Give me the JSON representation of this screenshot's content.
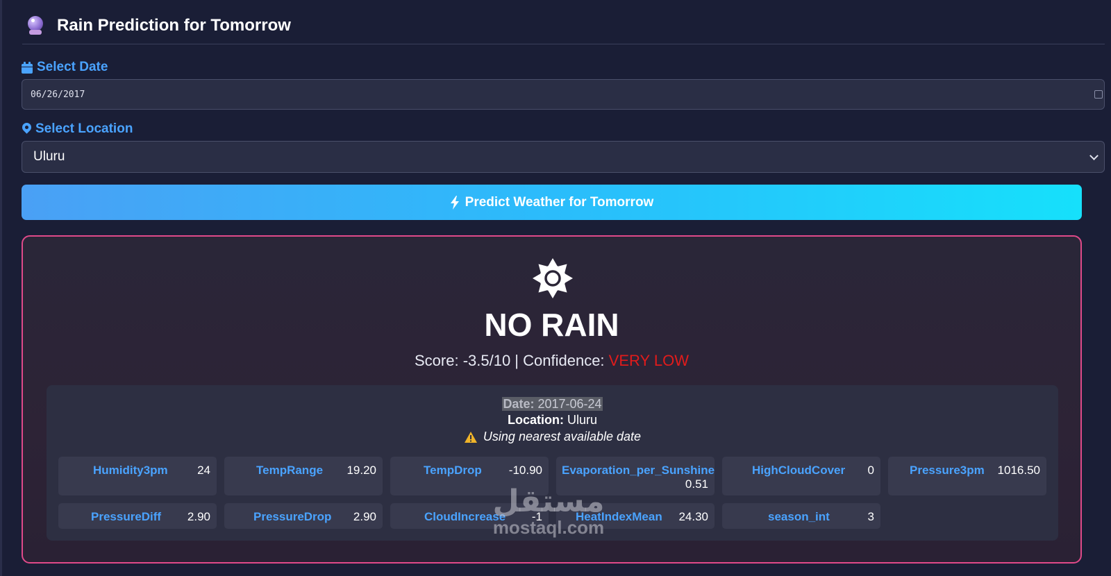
{
  "header": {
    "title": "Rain Prediction for Tomorrow",
    "icon": "crystal-ball-icon"
  },
  "date_field": {
    "label": "Select Date",
    "value": "06/26/2017",
    "icon": "calendar-icon"
  },
  "location_field": {
    "label": "Select Location",
    "value": "Uluru",
    "icon": "map-pin-icon"
  },
  "predict_button": {
    "label": "Predict Weather for Tomorrow",
    "icon": "bolt-icon"
  },
  "result": {
    "icon": "sun-icon",
    "title": "NO RAIN",
    "score_prefix": "Score: -3.5/10 | Confidence: ",
    "confidence": "VERY LOW",
    "confidence_color": "#e21b1b",
    "date_label": "Date:",
    "date_value": "2017-06-24",
    "location_label": "Location:",
    "location_value": "Uluru",
    "warning": "Using nearest available date",
    "features": [
      {
        "name": "Humidity3pm",
        "value": "24"
      },
      {
        "name": "TempRange",
        "value": "19.20"
      },
      {
        "name": "TempDrop",
        "value": "-10.90"
      },
      {
        "name": "Evaporation_per_Sunshine",
        "value": "0.51"
      },
      {
        "name": "HighCloudCover",
        "value": "0"
      },
      {
        "name": "Pressure3pm",
        "value": "1016.50"
      },
      {
        "name": "PressureDiff",
        "value": "2.90"
      },
      {
        "name": "PressureDrop",
        "value": "2.90"
      },
      {
        "name": "CloudIncrease",
        "value": "-1"
      },
      {
        "name": "HeatIndexMean",
        "value": "24.30"
      },
      {
        "name": "season_int",
        "value": "3"
      }
    ]
  },
  "watermark": {
    "arabic": "مستقل",
    "latin": "mostaql.com"
  },
  "colors": {
    "accent": "#4aa3ff",
    "card_border": "#e04a8a",
    "background": "#1a1e36"
  }
}
